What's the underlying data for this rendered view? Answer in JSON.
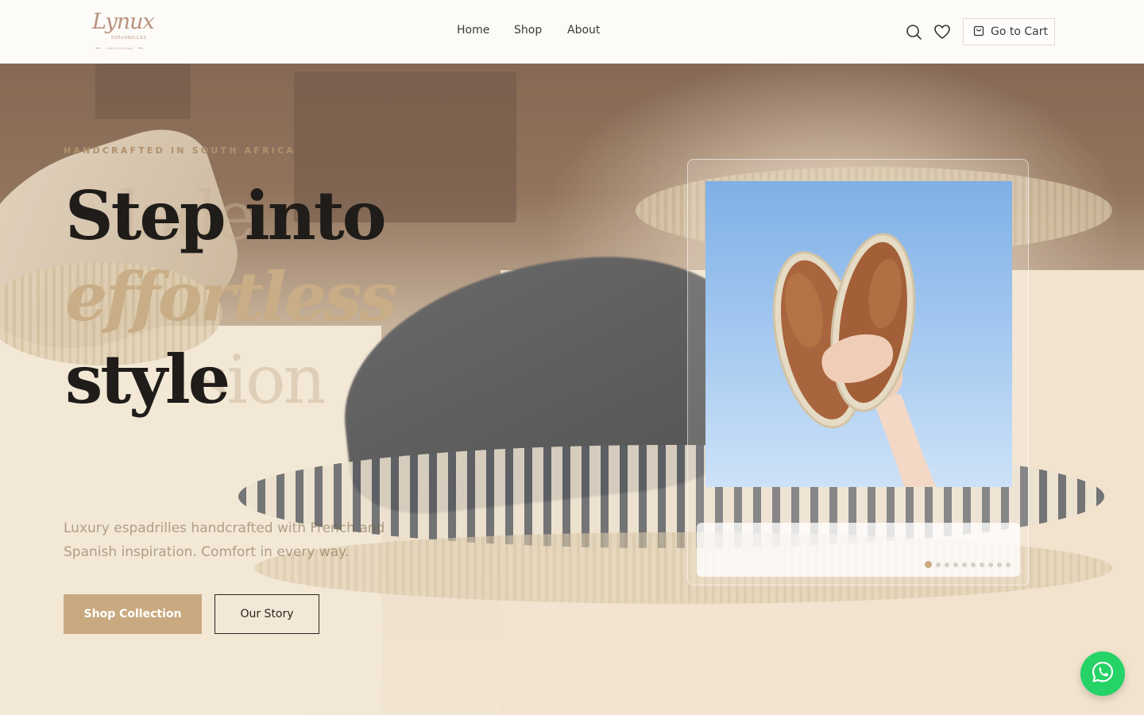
{
  "brand": {
    "logo_script": "Lynux",
    "logo_name": "ESPADRILLES",
    "logo_tagline": "comfort in every step"
  },
  "nav": {
    "items": [
      {
        "label": "Home"
      },
      {
        "label": "Shop"
      },
      {
        "label": "About"
      }
    ]
  },
  "header": {
    "cart_label": "Go to Cart"
  },
  "icons": {
    "search": "search-icon",
    "wishlist": "heart-icon",
    "cart": "shopping-bag-icon",
    "whatsapp": "whatsapp-icon"
  },
  "hero": {
    "eyebrow": "HANDCRAFTED IN SOUTH AFRICA",
    "headline_line1": "Step into",
    "headline_line2": "effortless",
    "headline_line3": "style",
    "subtext": "Luxury espadrilles handcrafted with French and Spanish inspiration. Comfort in every way.",
    "primary_cta": "Shop Collection",
    "secondary_cta": "Our Story"
  },
  "carousel": {
    "slide_count": 10,
    "active_index": 0
  },
  "colors": {
    "accent": "#c9aa80",
    "text_dark": "#1f1c19",
    "whatsapp": "#25d366"
  }
}
